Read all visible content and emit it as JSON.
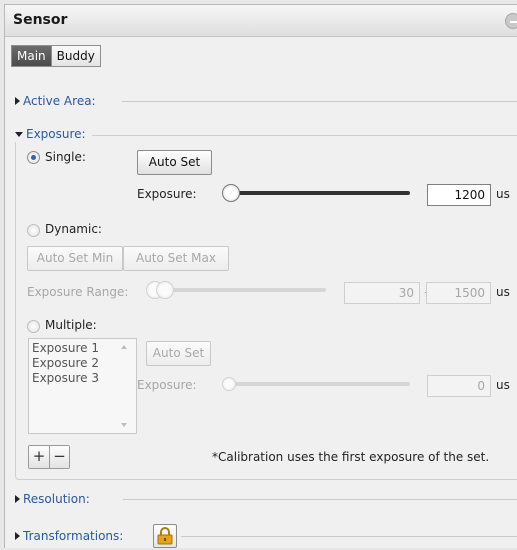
{
  "panel": {
    "title": "Sensor"
  },
  "tabs": [
    {
      "label": "Main",
      "active": true
    },
    {
      "label": "Buddy",
      "active": false
    }
  ],
  "sections": {
    "active_area": "Active Area:",
    "exposure": "Exposure:",
    "resolution": "Resolution:",
    "transformations": "Transformations:"
  },
  "exposure": {
    "single": {
      "label": "Single:",
      "selected": true,
      "auto_set": "Auto Set",
      "exposure_label": "Exposure:",
      "value": "1200",
      "unit": "us"
    },
    "dynamic": {
      "label": "Dynamic:",
      "selected": false,
      "auto_set_min": "Auto Set Min",
      "auto_set_max": "Auto Set Max",
      "range_label": "Exposure Range:",
      "min": "30",
      "separator": "-",
      "max": "1500",
      "unit": "us"
    },
    "multiple": {
      "label": "Multiple:",
      "selected": false,
      "items": [
        "Exposure 1",
        "Exposure 2",
        "Exposure 3"
      ],
      "auto_set": "Auto Set",
      "exposure_label": "Exposure:",
      "value": "0",
      "unit": "us",
      "add": "+",
      "remove": "−",
      "note": "*Calibration uses the first exposure of the set."
    }
  },
  "icons": {
    "collapse": "minus-circle-icon",
    "lock": "lock-icon"
  },
  "colors": {
    "section_label": "#2b57a4",
    "active_tab": "#555555",
    "radio_selected": "#2f63b5",
    "lock": "#e2a514"
  }
}
